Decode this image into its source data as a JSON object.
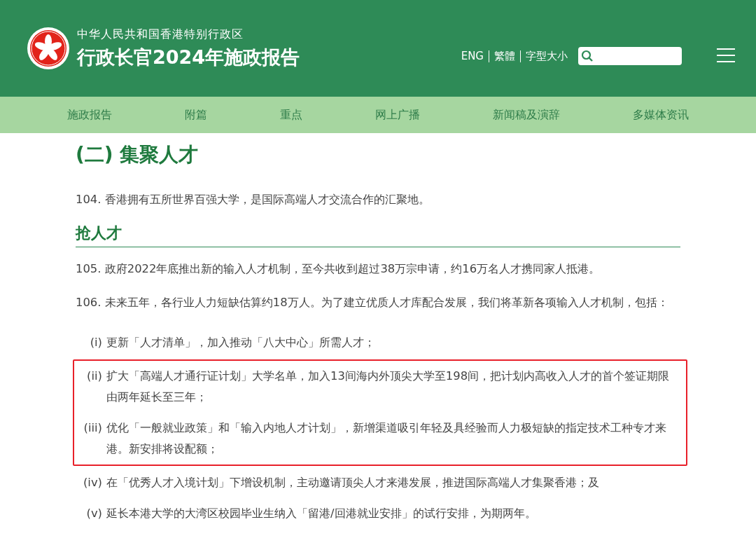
{
  "header": {
    "subtitle": "中华人民共和国香港特别行政区",
    "title": "行政长官2024年施政报告",
    "links": [
      "ENG",
      "繁體",
      "字型大小"
    ]
  },
  "nav": [
    "施政报告",
    "附篇",
    "重点",
    "网上广播",
    "新闻稿及演辞",
    "多媒体资讯"
  ],
  "section_title": "(二) 集聚人才",
  "intro": "104. 香港拥有五所世界百强大学，是国际高端人才交流合作的汇聚地。",
  "subsection_title": "抢人才",
  "paragraphs": [
    "105. 政府2022年底推出新的输入人才机制，至今共收到超过38万宗申请，约16万名人才携同家人抵港。",
    "106. 未来五年，各行业人力短缺估算约18万人。为了建立优质人才库配合发展，我们将革新各项输入人才机制，包括："
  ],
  "items": [
    {
      "marker": "(i)",
      "text": "更新「人才清单」，加入推动「八大中心」所需人才；",
      "highlighted": false
    },
    {
      "marker": "(ii)",
      "text": "扩大「高端人才通行证计划」大学名单，加入13间海内外顶尖大学至198间，把计划内高收入人才的首个签证期限由两年延长至三年；",
      "highlighted": true
    },
    {
      "marker": "(iii)",
      "text": "优化「一般就业政策」和「输入内地人才计划」，新增渠道吸引年轻及具经验而人力极短缺的指定技术工种专才来港。新安排将设配额；",
      "highlighted": true
    },
    {
      "marker": "(iv)",
      "text": "在「优秀人才入境计划」下增设机制，主动邀请顶尖人才来港发展，推进国际高端人才集聚香港；及",
      "highlighted": false
    },
    {
      "marker": "(v)",
      "text": "延长本港大学的大湾区校园毕业生纳入「留港/回港就业安排」的试行安排，为期两年。",
      "highlighted": false
    }
  ]
}
